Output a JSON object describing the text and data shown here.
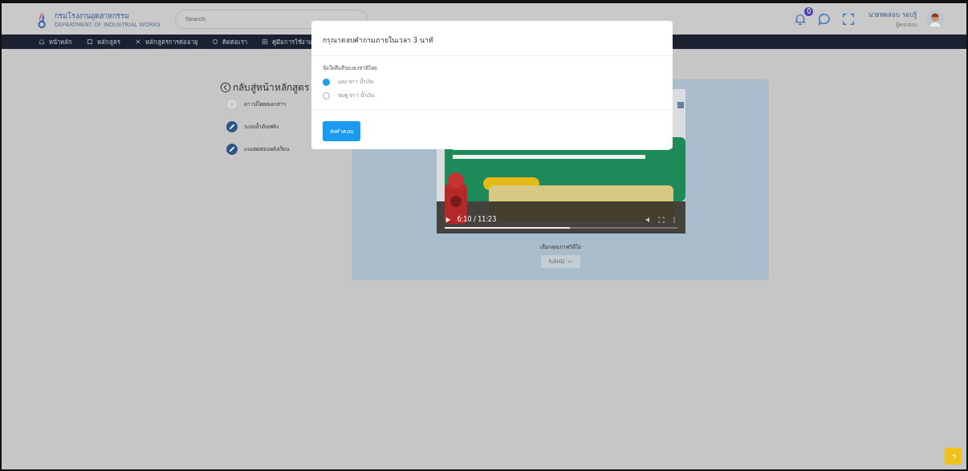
{
  "header": {
    "logo_title": "กรมโรงงานอุตสาหกรรม",
    "logo_subtitle": "DEPARTMENT OF INDUSTRIAL WORKS",
    "search": {
      "placeholder": "Search"
    },
    "notification_count": "0",
    "user_name": "นายทดสอบ รอบรู้",
    "user_role": "ผู้ทดสอบ"
  },
  "nav": [
    {
      "label": "หน้าหลัก"
    },
    {
      "label": "หลักสูตร"
    },
    {
      "label": "หลักสูตรการต่ออายุ"
    },
    {
      "label": "ติดต่อเรา"
    },
    {
      "label": "คู่มือการใช้งาน"
    }
  ],
  "sidebar": {
    "back_link": "กลับสู่หน้าหลักสูตร",
    "steps": [
      {
        "label": "ดาวน์โหลดเอกสาร",
        "done": false
      },
      {
        "label": "ระบบน้ำดับเพลิง",
        "done": true
      },
      {
        "label": "แบบทดสอบหลังเรียน",
        "done": true
      }
    ]
  },
  "video": {
    "time": "6:10 / 11:23",
    "progress": {
      "level": 0.54
    },
    "quality_label": "เลือกคุณภาพวิดีโอ",
    "quality": "fullHD"
  },
  "modal": {
    "title": "กรุณาตอบคำถามภายในเวลา 3 นาที",
    "question": "ข้อใดคือสีของธงชาติไทย",
    "options": [
      {
        "label": "แดง ขาว น้ำเงิน",
        "selected": true
      },
      {
        "label": "ชมพู ขาว น้ำเงิน",
        "selected": false
      }
    ],
    "submit": "ส่งคำตอบ"
  }
}
